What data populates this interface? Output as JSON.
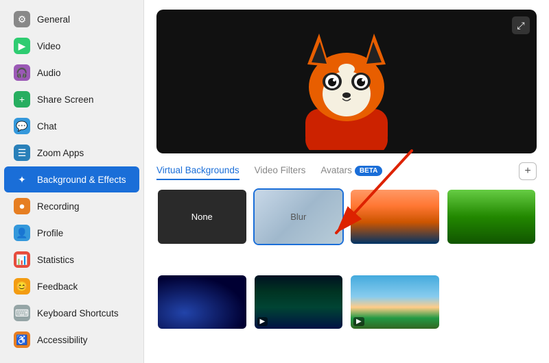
{
  "sidebar": {
    "items": [
      {
        "id": "general",
        "label": "General",
        "icon": "general",
        "active": false
      },
      {
        "id": "video",
        "label": "Video",
        "icon": "video",
        "active": false
      },
      {
        "id": "audio",
        "label": "Audio",
        "icon": "audio",
        "active": false
      },
      {
        "id": "share-screen",
        "label": "Share Screen",
        "icon": "share",
        "active": false
      },
      {
        "id": "chat",
        "label": "Chat",
        "icon": "chat",
        "active": false
      },
      {
        "id": "zoom-apps",
        "label": "Zoom Apps",
        "icon": "zoom",
        "active": false
      },
      {
        "id": "background-effects",
        "label": "Background & Effects",
        "icon": "bg",
        "active": true
      },
      {
        "id": "recording",
        "label": "Recording",
        "icon": "recording",
        "active": false
      },
      {
        "id": "profile",
        "label": "Profile",
        "icon": "profile",
        "active": false
      },
      {
        "id": "statistics",
        "label": "Statistics",
        "icon": "stats",
        "active": false
      },
      {
        "id": "feedback",
        "label": "Feedback",
        "icon": "feedback",
        "active": false
      },
      {
        "id": "keyboard-shortcuts",
        "label": "Keyboard Shortcuts",
        "icon": "keyboard",
        "active": false
      },
      {
        "id": "accessibility",
        "label": "Accessibility",
        "icon": "access",
        "active": false
      }
    ]
  },
  "main": {
    "tabs": [
      {
        "id": "virtual-backgrounds",
        "label": "Virtual Backgrounds",
        "active": true
      },
      {
        "id": "video-filters",
        "label": "Video Filters",
        "active": false
      },
      {
        "id": "avatars",
        "label": "Avatars",
        "active": false,
        "beta": true
      }
    ],
    "add_button_label": "+",
    "expand_icon": "⤢",
    "backgrounds": [
      {
        "id": "none",
        "label": "None",
        "type": "none",
        "selected": false
      },
      {
        "id": "blur",
        "label": "Blur",
        "type": "blur",
        "selected": true
      },
      {
        "id": "golden-gate",
        "label": "",
        "type": "golden-gate",
        "selected": false
      },
      {
        "id": "nature",
        "label": "",
        "type": "nature",
        "selected": false
      },
      {
        "id": "space",
        "label": "",
        "type": "space",
        "selected": false,
        "hasVideo": false
      },
      {
        "id": "aurora",
        "label": "",
        "type": "aurora",
        "selected": false,
        "hasVideo": true
      },
      {
        "id": "beach",
        "label": "",
        "type": "beach",
        "selected": false,
        "hasVideo": true
      }
    ]
  }
}
